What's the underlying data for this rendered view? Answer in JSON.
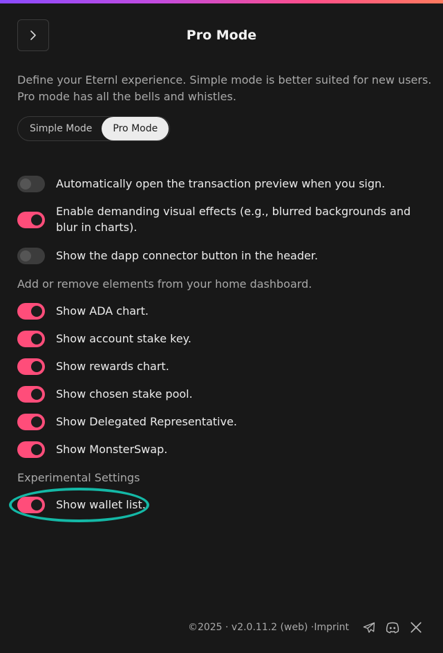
{
  "header": {
    "title": "Pro Mode"
  },
  "description": "Define your Eternl experience. Simple mode is better suited for new users. Pro mode has all the bells and whistles.",
  "mode_switch": {
    "options": [
      "Simple Mode",
      "Pro Mode"
    ],
    "selected": "Pro Mode"
  },
  "general_settings": [
    {
      "label": "Automatically open the transaction preview when you sign.",
      "enabled": false
    },
    {
      "label": "Enable demanding visual effects (e.g., blurred backgrounds and blur in charts).",
      "enabled": true
    },
    {
      "label": "Show the dapp connector button in the header.",
      "enabled": false
    }
  ],
  "dashboard_section": {
    "label": "Add or remove elements from your home dashboard.",
    "items": [
      {
        "label": "Show ADA chart.",
        "enabled": true
      },
      {
        "label": "Show account stake key.",
        "enabled": true
      },
      {
        "label": "Show rewards chart.",
        "enabled": true
      },
      {
        "label": "Show chosen stake pool.",
        "enabled": true
      },
      {
        "label": "Show Delegated Representative.",
        "enabled": true
      },
      {
        "label": "Show MonsterSwap.",
        "enabled": true
      }
    ]
  },
  "experimental_section": {
    "label": "Experimental Settings",
    "items": [
      {
        "label": "Show wallet list.",
        "enabled": true
      }
    ]
  },
  "footer": {
    "copyright": "©2025 · v2.0.11.2 (web) · ",
    "imprint": "Imprint",
    "icons": [
      "telegram-icon",
      "discord-icon",
      "x-icon"
    ]
  },
  "colors": {
    "accent": "#ff4d7a",
    "highlight": "#14b8a6",
    "background": "#181818"
  }
}
